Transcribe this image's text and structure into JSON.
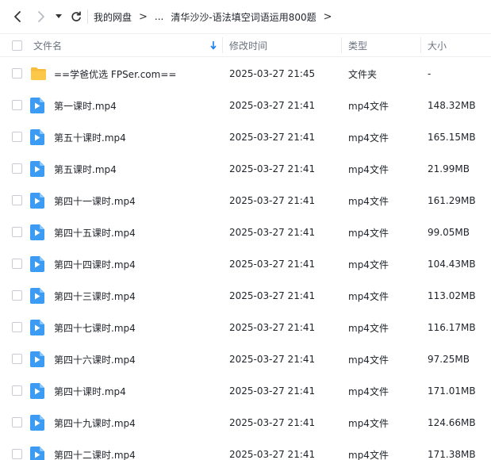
{
  "breadcrumb": {
    "root": "我的网盘",
    "ellipsis": "...",
    "current": "清华沙沙-语法填空词语运用800题",
    "separator": ">"
  },
  "columns": {
    "name": "文件名",
    "modified": "修改时间",
    "type": "类型",
    "size": "大小",
    "sort_icon": "sort-down-arrow-icon"
  },
  "colors": {
    "accent": "#1a7df1",
    "folder": "#f7bd3b",
    "video": "#3c9cf4"
  },
  "files": [
    {
      "name": "==学爸优选 FPSer.com==",
      "modified": "2025-03-27 21:45",
      "type": "文件夹",
      "size": "-",
      "kind": "folder"
    },
    {
      "name": "第一课时.mp4",
      "modified": "2025-03-27 21:41",
      "type": "mp4文件",
      "size": "148.32MB",
      "kind": "video"
    },
    {
      "name": "第五十课时.mp4",
      "modified": "2025-03-27 21:41",
      "type": "mp4文件",
      "size": "165.15MB",
      "kind": "video"
    },
    {
      "name": "第五课时.mp4",
      "modified": "2025-03-27 21:41",
      "type": "mp4文件",
      "size": "21.99MB",
      "kind": "video"
    },
    {
      "name": "第四十一课时.mp4",
      "modified": "2025-03-27 21:41",
      "type": "mp4文件",
      "size": "161.29MB",
      "kind": "video"
    },
    {
      "name": "第四十五课时.mp4",
      "modified": "2025-03-27 21:41",
      "type": "mp4文件",
      "size": "99.05MB",
      "kind": "video"
    },
    {
      "name": "第四十四课时.mp4",
      "modified": "2025-03-27 21:41",
      "type": "mp4文件",
      "size": "104.43MB",
      "kind": "video"
    },
    {
      "name": "第四十三课时.mp4",
      "modified": "2025-03-27 21:41",
      "type": "mp4文件",
      "size": "113.02MB",
      "kind": "video"
    },
    {
      "name": "第四十七课时.mp4",
      "modified": "2025-03-27 21:41",
      "type": "mp4文件",
      "size": "116.17MB",
      "kind": "video"
    },
    {
      "name": "第四十六课时.mp4",
      "modified": "2025-03-27 21:41",
      "type": "mp4文件",
      "size": "97.25MB",
      "kind": "video"
    },
    {
      "name": "第四十课时.mp4",
      "modified": "2025-03-27 21:41",
      "type": "mp4文件",
      "size": "171.01MB",
      "kind": "video"
    },
    {
      "name": "第四十九课时.mp4",
      "modified": "2025-03-27 21:41",
      "type": "mp4文件",
      "size": "124.66MB",
      "kind": "video"
    },
    {
      "name": "第四十二课时.mp4",
      "modified": "2025-03-27 21:41",
      "type": "mp4文件",
      "size": "171.38MB",
      "kind": "video"
    }
  ]
}
